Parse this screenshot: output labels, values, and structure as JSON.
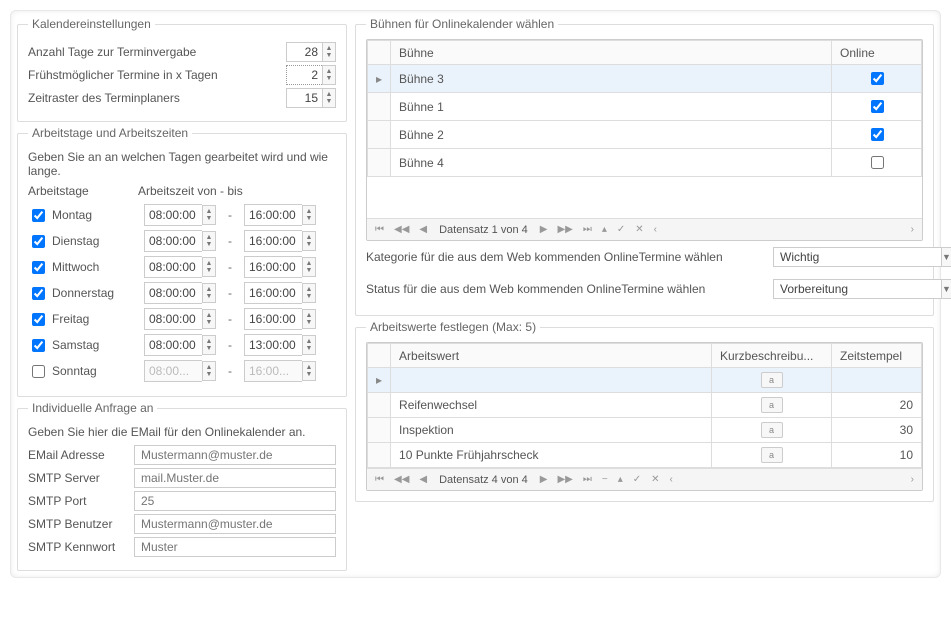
{
  "calendar": {
    "legend": "Kalendereinstellungen",
    "days_label": "Anzahl Tage zur Terminvergabe",
    "days_value": "28",
    "earliest_label": "Frühstmöglicher Termine in x Tagen",
    "earliest_value": "2",
    "raster_label": "Zeitraster des Terminplaners",
    "raster_value": "15"
  },
  "worktimes": {
    "legend": "Arbeitstage und Arbeitszeiten",
    "note": "Geben Sie an an welchen Tagen gearbeitet wird und wie lange.",
    "col_days": "Arbeitstage",
    "col_time": "Arbeitszeit von - bis",
    "days": [
      {
        "name": "Montag",
        "checked": true,
        "from": "08:00:00",
        "to": "16:00:00",
        "enabled": true
      },
      {
        "name": "Dienstag",
        "checked": true,
        "from": "08:00:00",
        "to": "16:00:00",
        "enabled": true
      },
      {
        "name": "Mittwoch",
        "checked": true,
        "from": "08:00:00",
        "to": "16:00:00",
        "enabled": true
      },
      {
        "name": "Donnerstag",
        "checked": true,
        "from": "08:00:00",
        "to": "16:00:00",
        "enabled": true
      },
      {
        "name": "Freitag",
        "checked": true,
        "from": "08:00:00",
        "to": "16:00:00",
        "enabled": true
      },
      {
        "name": "Samstag",
        "checked": true,
        "from": "08:00:00",
        "to": "13:00:00",
        "enabled": true
      },
      {
        "name": "Sonntag",
        "checked": false,
        "from": "08:00...",
        "to": "16:00...",
        "enabled": false
      }
    ]
  },
  "inquiry": {
    "legend": "Individuelle Anfrage an",
    "note": "Geben Sie hier die EMail für den Onlinekalender an.",
    "fields": [
      {
        "label": "EMail Adresse",
        "placeholder": "Mustermann@muster.de"
      },
      {
        "label": "SMTP Server",
        "placeholder": "mail.Muster.de"
      },
      {
        "label": "SMTP Port",
        "placeholder": "25"
      },
      {
        "label": "SMTP Benutzer",
        "placeholder": "Mustermann@muster.de"
      },
      {
        "label": "SMTP Kennwort",
        "placeholder": "Muster"
      }
    ]
  },
  "stages": {
    "legend": "Bühnen für Onlinekalender wählen",
    "col_stage": "Bühne",
    "col_online": "Online",
    "rows": [
      {
        "name": "Bühne 3",
        "online": true,
        "current": true
      },
      {
        "name": "Bühne 1",
        "online": true
      },
      {
        "name": "Bühne 2",
        "online": true
      },
      {
        "name": "Bühne 4",
        "online": false
      }
    ],
    "nav": "Datensatz 1 von 4"
  },
  "combos": {
    "category_label": "Kategorie für die aus dem Web kommenden OnlineTermine wählen",
    "category_value": "Wichtig",
    "status_label": "Status für die aus dem Web kommenden OnlineTermine wählen",
    "status_value": "Vorbereitung"
  },
  "arbeitswerte": {
    "legend": "Arbeitswerte festlegen (Max: 5)",
    "col_name": "Arbeitswert",
    "col_kurz": "Kurzbeschreibu...",
    "col_zeit": "Zeitstempel",
    "rows": [
      {
        "name": "",
        "zeit": "",
        "current": true
      },
      {
        "name": "Reifenwechsel",
        "zeit": "20"
      },
      {
        "name": "Inspektion",
        "zeit": "30"
      },
      {
        "name": "10 Punkte Frühjahrscheck",
        "zeit": "10"
      }
    ],
    "nav": "Datensatz 4 von 4"
  },
  "nav_icons": {
    "first": "⏮",
    "prevpg": "◀◀",
    "prev": "◀",
    "next": "▶",
    "nextpg": "▶▶",
    "last": "⏭",
    "minus": "−",
    "expand": "▴",
    "check": "✓",
    "cancel": "✕",
    "more": "‹"
  }
}
